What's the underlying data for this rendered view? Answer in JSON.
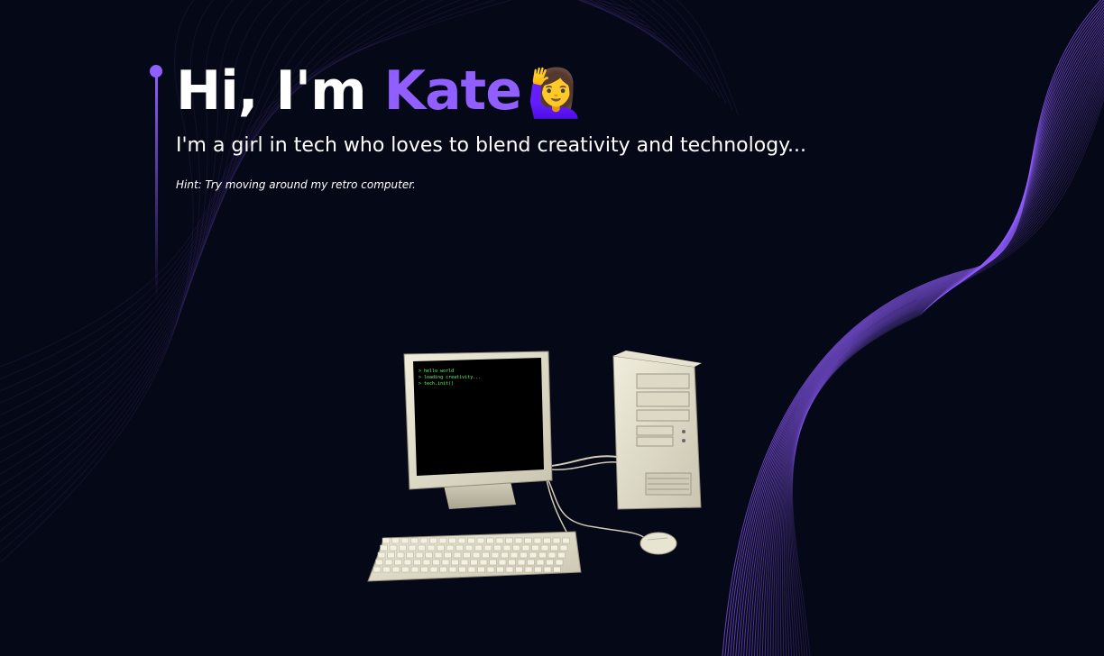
{
  "hero": {
    "greeting": "Hi, I'm ",
    "name": "Kate",
    "wave_emoji": "🙋‍♀️",
    "subtitle": "I'm a girl in tech who loves to blend creativity and technology...",
    "hint": "Hint: Try moving around my retro computer."
  },
  "computer": {
    "terminal_lines": [
      "> hello world",
      "> loading creativity...",
      "> tech.init()"
    ]
  },
  "colors": {
    "accent": "#915eff",
    "background": "#050816",
    "terminal_text": "#5dff5d"
  }
}
